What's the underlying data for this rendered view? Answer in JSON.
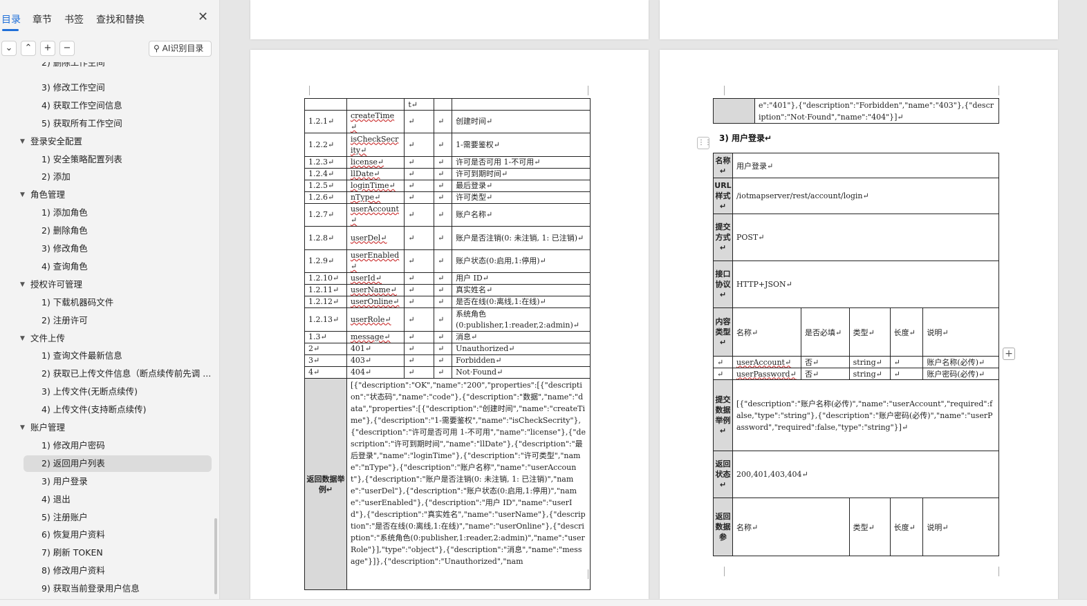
{
  "sidebar": {
    "tabs": [
      "目录",
      "章节",
      "书签",
      "查找和替换"
    ],
    "ai_button": "AI识别目录",
    "tools": [
      "⌄",
      "⌃",
      "+",
      "−"
    ],
    "toc": [
      {
        "label": "2) 删除工作空间",
        "level": 2,
        "clipped": true
      },
      {
        "label": "3) 修改工作空间",
        "level": 2
      },
      {
        "label": "4) 获取工作空间信息",
        "level": 2
      },
      {
        "label": "5) 获取所有工作空间",
        "level": 2
      },
      {
        "label": "登录安全配置",
        "level": 1
      },
      {
        "label": "1) 安全策略配置列表",
        "level": 2
      },
      {
        "label": "2) 添加",
        "level": 2
      },
      {
        "label": "角色管理",
        "level": 1
      },
      {
        "label": "1) 添加角色",
        "level": 2
      },
      {
        "label": "2) 删除角色",
        "level": 2
      },
      {
        "label": "3) 修改角色",
        "level": 2
      },
      {
        "label": "4) 查询角色",
        "level": 2
      },
      {
        "label": "授权许可管理",
        "level": 1
      },
      {
        "label": "1) 下载机器码文件",
        "level": 2
      },
      {
        "label": "2) 注册许可",
        "level": 2
      },
      {
        "label": "文件上传",
        "level": 1
      },
      {
        "label": "1) 查询文件最新信息",
        "level": 2
      },
      {
        "label": "2) 获取已上传文件信息（断点续传前先调 ...",
        "level": 2
      },
      {
        "label": "3) 上传文件(无断点续传)",
        "level": 2
      },
      {
        "label": "4) 上传文件(支持断点续传)",
        "level": 2
      },
      {
        "label": "账户管理",
        "level": 1
      },
      {
        "label": "1) 修改用户密码",
        "level": 2
      },
      {
        "label": "2) 返回用户列表",
        "level": 2,
        "selected": true
      },
      {
        "label": "3) 用户登录",
        "level": 2
      },
      {
        "label": "4) 退出",
        "level": 2
      },
      {
        "label": "5) 注册账户",
        "level": 2
      },
      {
        "label": "6) 恢复用户资料",
        "level": 2
      },
      {
        "label": "7) 刷新 TOKEN",
        "level": 2
      },
      {
        "label": "8) 修改用户资料",
        "level": 2
      },
      {
        "label": "9) 获取当前登录用户信息",
        "level": 2
      }
    ]
  },
  "left_table": {
    "header_mark": "t↵",
    "rows": [
      [
        "1.2.1↵",
        "createTime↵",
        "↵",
        "↵",
        "创建时间↵"
      ],
      [
        "1.2.2↵",
        "isCheckSecrity↵",
        "↵",
        "↵",
        "1-需要鉴权↵"
      ],
      [
        "1.2.3↵",
        "license↵",
        "↵",
        "↵",
        "许可是否可用 1-不可用↵"
      ],
      [
        "1.2.4↵",
        "llDate↵",
        "↵",
        "↵",
        "许可到期时间↵"
      ],
      [
        "1.2.5↵",
        "loginTime↵",
        "↵",
        "↵",
        "最后登录↵"
      ],
      [
        "1.2.6↵",
        "nType↵",
        "↵",
        "↵",
        "许可类型↵"
      ],
      [
        "1.2.7↵",
        "userAccount↵",
        "↵",
        "↵",
        "账户名称↵"
      ],
      [
        "1.2.8↵",
        "userDel↵",
        "↵",
        "↵",
        "账户是否注销(0: 未注销, 1: 已注销)↵"
      ],
      [
        "1.2.9↵",
        "userEnabled↵",
        "↵",
        "↵",
        "账户状态(0:启用,1:停用)↵"
      ],
      [
        "1.2.10↵",
        "userId↵",
        "↵",
        "↵",
        "用户 ID↵"
      ],
      [
        "1.2.11↵",
        "userName↵",
        "↵",
        "↵",
        "真实姓名↵"
      ],
      [
        "1.2.12↵",
        "userOnline↵",
        "↵",
        "↵",
        "是否在线(0:离线,1:在线)↵"
      ],
      [
        "1.2.13↵",
        "userRole↵",
        "↵",
        "↵",
        "系统角色(0:publisher,1:reader,2:admin)↵"
      ],
      [
        "1.3↵",
        "message↵",
        "↵",
        "↵",
        "消息↵"
      ],
      [
        "2↵",
        "401↵",
        "↵",
        "↵",
        "Unauthorized↵"
      ],
      [
        "3↵",
        "403↵",
        "↵",
        "↵",
        "Forbidden↵"
      ],
      [
        "4↵",
        "404↵",
        "↵",
        "↵",
        "Not·Found↵"
      ]
    ],
    "return_label": "返回数据举例↵",
    "return_example": "[{\"description\":\"OK\",\"name\":\"200\",\"properties\":[{\"description\":\"状态码\",\"name\":\"code\"},{\"description\":\"数据\",\"name\":\"data\",\"properties\":[{\"description\":\"创建时间\",\"name\":\"createTime\"},{\"description\":\"1-需要鉴权\",\"name\":\"isCheckSecrity\"},{\"description\":\"许可是否可用 1-不可用\",\"name\":\"license\"},{\"description\":\"许可到期时间\",\"name\":\"llDate\"},{\"description\":\"最后登录\",\"name\":\"loginTime\"},{\"description\":\"许可类型\",\"name\":\"nType\"},{\"description\":\"账户名称\",\"name\":\"userAccount\"},{\"description\":\"账户是否注销(0: 未注销, 1: 已注销)\",\"name\":\"userDel\"},{\"description\":\"账户状态(0:启用,1:停用)\",\"name\":\"userEnabled\"},{\"description\":\"用户 ID\",\"name\":\"userId\"},{\"description\":\"真实姓名\",\"name\":\"userName\"},{\"description\":\"是否在线(0:离线,1:在线)\",\"name\":\"userOnline\"},{\"description\":\"系统角色(0:publisher,1:reader,2:admin)\",\"name\":\"userRole\"}],\"type\":\"object\"},{\"description\":\"消息\",\"name\":\"message\"}]},{\"description\":\"Unauthorized\",\"nam"
  },
  "right_page": {
    "top_fragment": "e\":\"401\"},{\"description\":\"Forbidden\",\"name\":\"403\"},{\"description\":\"Not·Found\",\"name\":\"404\"}]↵",
    "heading": "3) 用户登录↵",
    "handle_icon": "⋮⋮",
    "plus_icon": "+",
    "rows": {
      "name_label": "名称↵",
      "name_value": "用户登录↵",
      "url_label": "URL样式↵",
      "url_value": "/iotmapserver/rest/account/login↵",
      "method_label": "提交方式↵",
      "method_value": "POST↵",
      "protocol_label": "接口协议↵",
      "protocol_value": "HTTP+JSON↵",
      "content_label": "内容类型↵",
      "content_headers": [
        "名称↵",
        "是否必填↵",
        "类型↵",
        "长度↵",
        "说明↵"
      ],
      "params": [
        [
          "↵",
          "userAccount↵",
          "否↵",
          "string↵",
          "↵",
          "账户名称(必传)↵"
        ],
        [
          "↵",
          "userPassword↵",
          "否↵",
          "string↵",
          "↵",
          "账户密码(必传)↵"
        ]
      ],
      "submit_label": "提交数据举例↵",
      "submit_value": "[{\"description\":\"账户名称(必传)\",\"name\":\"userAccount\",\"required\":false,\"type\":\"string\"},{\"description\":\"账户密码(必传)\",\"name\":\"userPassword\",\"required\":false,\"type\":\"string\"}]↵",
      "status_label": "返回状态↵",
      "status_value": "200,401,403,404↵",
      "return_label": "返回数据参",
      "return_headers": [
        "名称↵",
        "类型↵",
        "长度↵",
        "说明↵"
      ]
    }
  }
}
